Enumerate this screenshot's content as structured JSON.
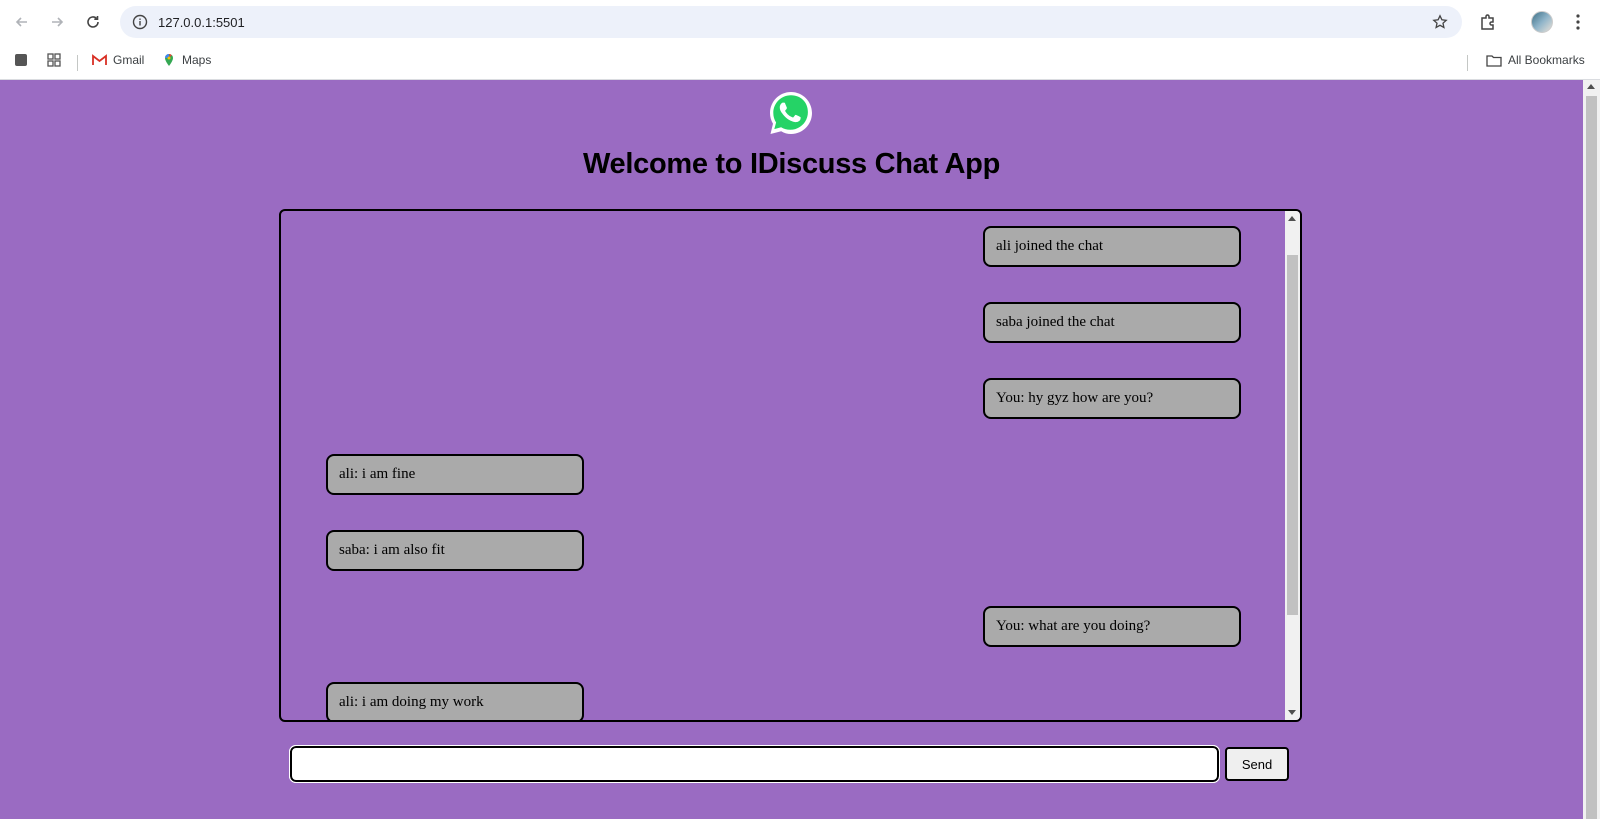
{
  "browser": {
    "url": "127.0.0.1:5501",
    "bookmarks": [
      {
        "label": "Gmail",
        "icon": "gmail-icon"
      },
      {
        "label": "Maps",
        "icon": "maps-icon"
      }
    ],
    "all_bookmarks_label": "All Bookmarks"
  },
  "page": {
    "title": "Welcome to IDiscuss Chat App",
    "background_color": "#9a6bc2",
    "logo_icon": "whatsapp-icon",
    "messages": [
      {
        "text": "ali joined the chat",
        "side": "right"
      },
      {
        "text": "saba joined the chat",
        "side": "right"
      },
      {
        "text": "You: hy gyz how are you?",
        "side": "right"
      },
      {
        "text": "ali: i am fine",
        "side": "left"
      },
      {
        "text": "saba: i am also fit",
        "side": "left"
      },
      {
        "text": "You: what are you doing?",
        "side": "right"
      },
      {
        "text": "ali: i am doing my work",
        "side": "left"
      }
    ],
    "input_value": "",
    "send_label": "Send"
  }
}
